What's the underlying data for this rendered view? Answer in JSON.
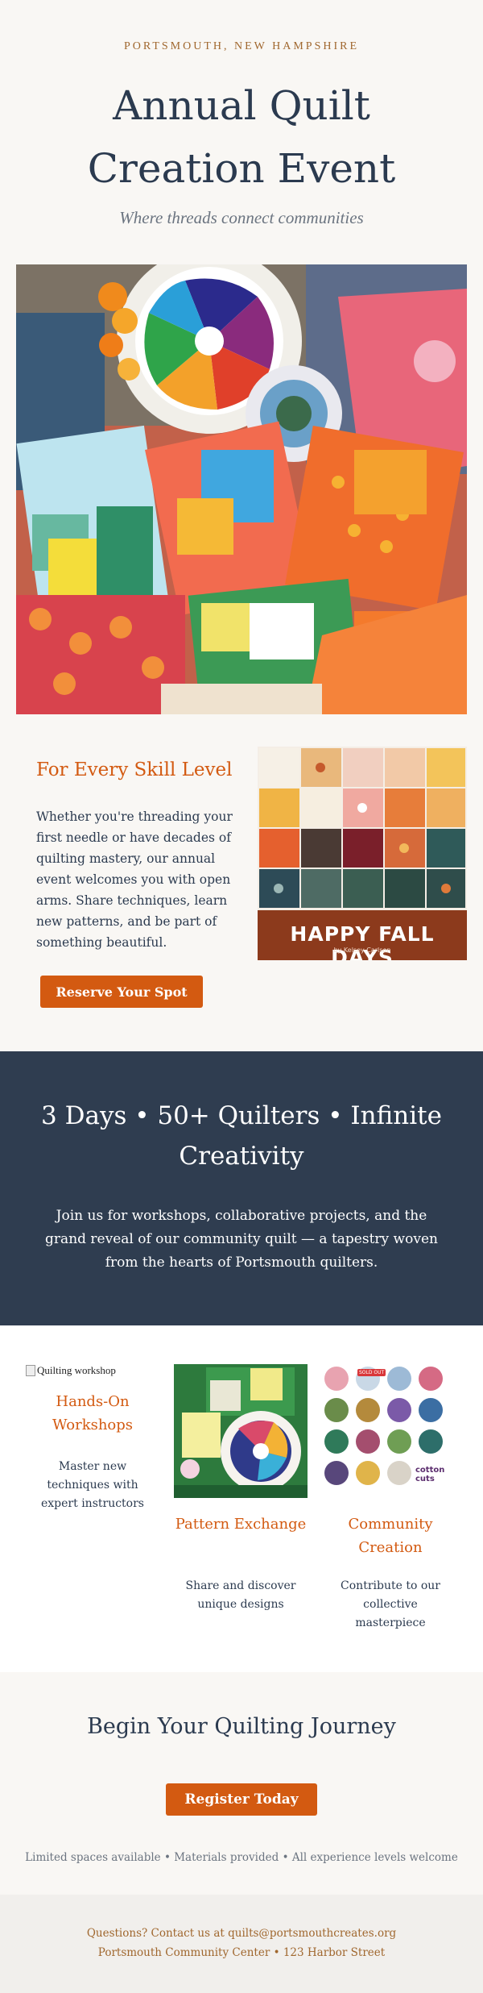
{
  "header": {
    "kicker": "PORTSMOUTH, NEW HAMPSHIRE",
    "title_line1": "Annual Quilt",
    "title_line2": "Creation Event",
    "subtitle": "Where threads connect communities"
  },
  "skill": {
    "heading": "For Every Skill Level",
    "body": "Whether you're threading your first needle or have decades of quilting mastery, our annual event welcomes you with open arms. Share techniques, learn new patterns, and be part of something beautiful.",
    "button_label": "Reserve Your Spot",
    "fabric_title": "HAPPY FALL DAYS",
    "fabric_byline": "by Kelsey Carlson"
  },
  "stats": {
    "title": "3 Days • 50+ Quilters • Infinite Creativity",
    "body": "Join us for workshops, collaborative projects, and the grand reveal of our community quilt — a tapestry woven from the hearts of Portsmouth quilters."
  },
  "features": [
    {
      "img_alt": "Quilting workshop",
      "title": "Hands-On Workshops",
      "text": "Master new techniques with expert instructors"
    },
    {
      "title": "Pattern Exchange",
      "text": "Share and discover unique designs"
    },
    {
      "title": "Community Creation",
      "text": "Contribute to our collective masterpiece",
      "logo_text": "cotton cuts",
      "badge_text": "SOLD OUT"
    }
  ],
  "cta": {
    "title": "Begin Your Quilting Journey",
    "button_label": "Register Today",
    "note": "Limited spaces available • Materials provided • All experience levels welcome"
  },
  "footer": {
    "contact": "Questions? Contact us at quilts@portsmouthcreates.org",
    "address": "Portsmouth Community Center • 123 Harbor Street"
  },
  "colors": {
    "accent": "#d35a11",
    "navy": "#2f3d50",
    "page_bg": "#f9f7f4",
    "brown": "#a0672e"
  }
}
